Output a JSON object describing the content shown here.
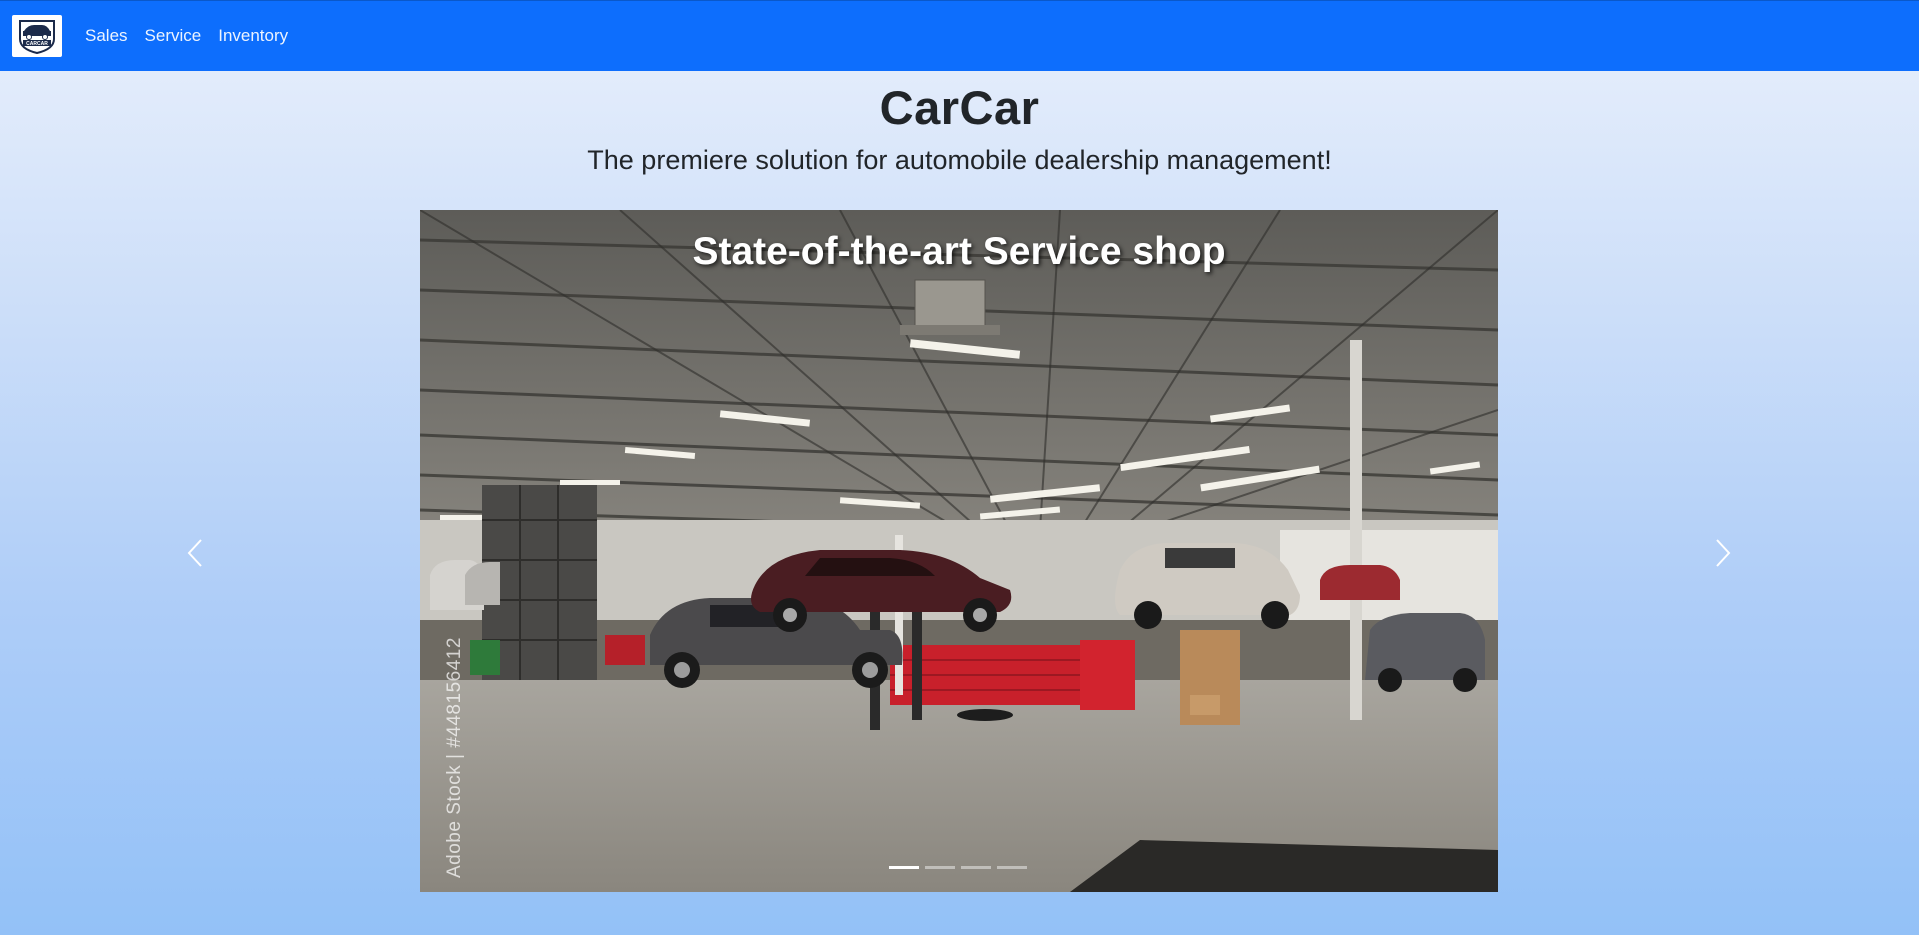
{
  "brand": {
    "logo_text": "CARCAR",
    "logo_icon": "car-logo-icon"
  },
  "nav": {
    "items": [
      {
        "label": "Sales"
      },
      {
        "label": "Service"
      },
      {
        "label": "Inventory"
      }
    ]
  },
  "hero": {
    "title": "CarCar",
    "subtitle": "The premiere solution for automobile dealership management!"
  },
  "carousel": {
    "active_index": 0,
    "slide_count": 4,
    "caption": "State-of-the-art Service shop",
    "watermark": "Adobe Stock | #448156412",
    "prev_icon": "chevron-left-icon",
    "next_icon": "chevron-right-icon"
  },
  "colors": {
    "navbar": "#0d6efd",
    "gradient_top": "#e9f0fc",
    "gradient_bottom": "#93c1f7",
    "toolbox_red": "#c8202b"
  }
}
